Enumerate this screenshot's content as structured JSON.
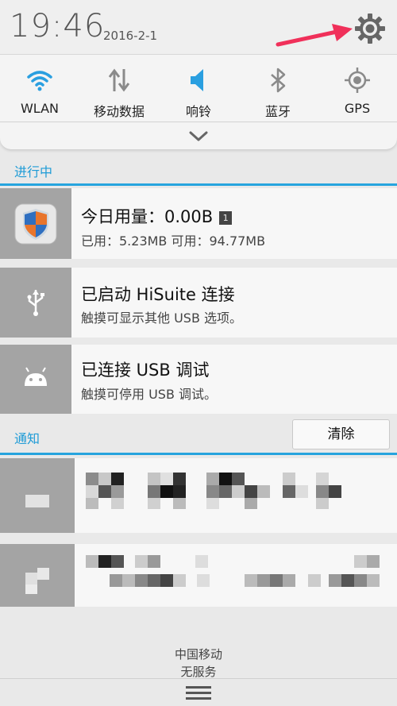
{
  "status": {
    "time": "19:46",
    "date": "2016-2-1"
  },
  "quick_settings": [
    {
      "label": "WLAN",
      "icon": "wifi-icon",
      "active": true
    },
    {
      "label": "移动数据",
      "icon": "mobile-data-icon",
      "active": false
    },
    {
      "label": "响铃",
      "icon": "ringer-icon",
      "active": true
    },
    {
      "label": "蓝牙",
      "icon": "bluetooth-icon",
      "active": false
    },
    {
      "label": "GPS",
      "icon": "gps-icon",
      "active": false
    }
  ],
  "ongoing": {
    "title": "进行中",
    "items": [
      {
        "title": "今日用量：0.00B",
        "badge": "1",
        "subtitle": "已用：5.23MB 可用：94.77MB",
        "icon": "shield-icon"
      },
      {
        "title": "已启动 HiSuite 连接",
        "subtitle": "触摸可显示其他 USB 选项。",
        "icon": "usb-icon"
      },
      {
        "title": "已连接 USB 调试",
        "subtitle": "触摸可停用 USB 调试。",
        "icon": "android-icon"
      }
    ]
  },
  "notifications": {
    "title": "通知",
    "clear_label": "清除"
  },
  "footer": {
    "carrier": "中国移动",
    "service": "无服务"
  },
  "colors": {
    "accent": "#1e9bd6",
    "arrow": "#f0305a",
    "icon_blue": "#2a9fe0",
    "icon_gray": "#8a8a8a"
  }
}
